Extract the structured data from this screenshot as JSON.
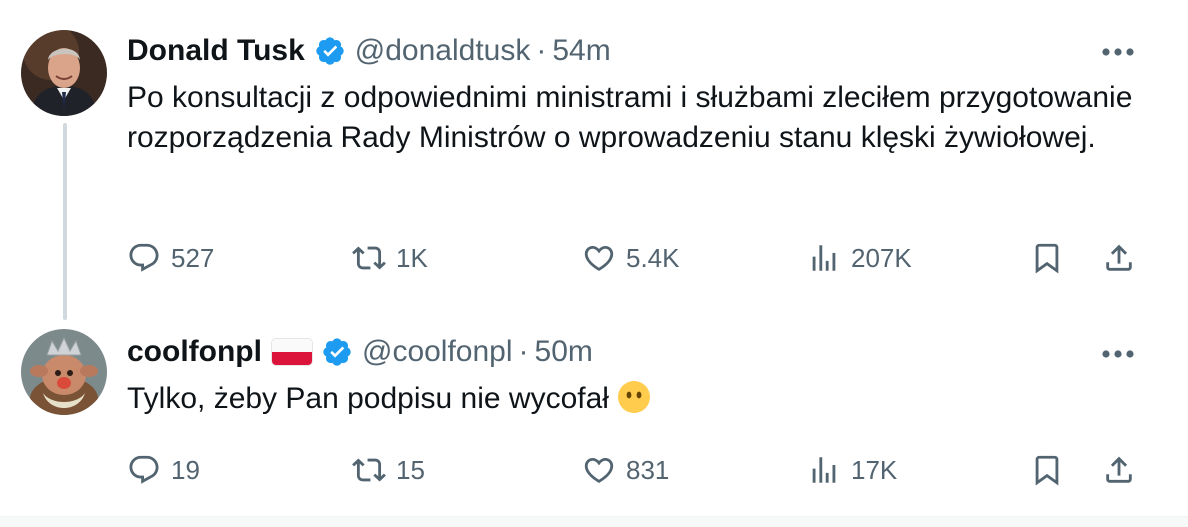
{
  "tweets": [
    {
      "display_name": "Donald Tusk",
      "verified": true,
      "handle": "@donaldtusk",
      "separator": "·",
      "time": "54m",
      "text": "Po konsultacji z odpowiednimi ministrami i służbami zleciłem przygotowanie rozporządzenia Rady Ministrów o wprowadzeniu stanu klęski żywiołowej.",
      "stats": {
        "replies": "527",
        "retweets": "1K",
        "likes": "5.4K",
        "views": "207K"
      }
    },
    {
      "display_name": "coolfonpl",
      "verified": true,
      "flag_icon": "poland-flag-icon",
      "handle": "@coolfonpl",
      "separator": "·",
      "time": "50m",
      "text": "Tylko, żeby Pan podpisu nie wycofał",
      "emoji_icon": "face-without-mouth-icon",
      "stats": {
        "replies": "19",
        "retweets": "15",
        "likes": "831",
        "views": "17K"
      }
    }
  ],
  "colors": {
    "text": "#0f1419",
    "secondary": "#536471",
    "verified": "#1d9bf0",
    "thread_line": "#cfd9de"
  }
}
